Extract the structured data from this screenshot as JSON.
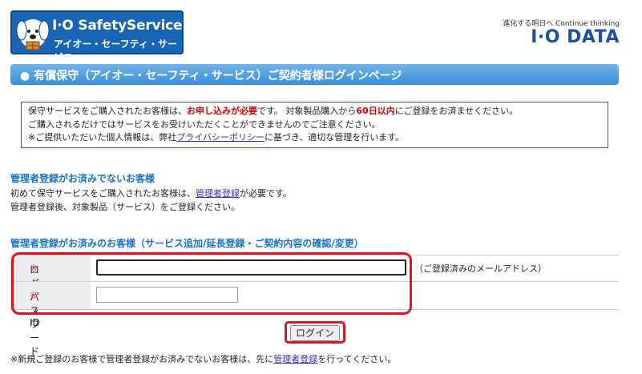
{
  "header": {
    "logo_title": "I·O SafetyService",
    "logo_subtitle": "アイオー・セーフティ・サービス",
    "tagline": "進化する明日へ Continue thinking",
    "brand": "I·O DATA"
  },
  "page_title": "● 有償保守（アイオー・セーフティ・サービス）ご契約者様ログインページ",
  "notice": {
    "line1_a": "保守サービスをご購入されたお客様は、",
    "line1_red": "お申し込みが必要",
    "line1_b": "です。 対象製品購入から",
    "line1_red2": "60日以内",
    "line1_c": "にご登録をお済ませください。",
    "line2": "ご購入されるだけではサービスをお受けいただくことができませんのでご注意ください。",
    "line3_a": "※ご提供いただいた個人情報は、弊社",
    "line3_link": "プライバシーポリシー",
    "line3_b": "に基づき、適切な管理を行います。"
  },
  "unregistered": {
    "heading": "管理者登録がお済みでないお客様",
    "line1_a": "初めて保守サービスをご購入されたお客様は、",
    "line1_link": "管理者登録",
    "line1_b": "が必要です。",
    "line2": "管理者登録後、対象製品（サービス）をご登録ください。"
  },
  "registered": {
    "heading": "管理者登録がお済みのお客様（サービス追加/延長登録・ご契約内容の確認/変更）"
  },
  "form": {
    "login_id_label": "ログインID",
    "password_label": "パスワード",
    "required_mark": "※",
    "login_id_value": "",
    "password_value": "",
    "login_id_hint": "（ご登録済みのメールアドレス）",
    "submit_label": "ログイン"
  },
  "footer": {
    "text_a": "※新規ご登録のお客様で管理者登録がお済みでないお客様は、先に",
    "link": "管理者登録",
    "text_b": "を行ってください。"
  },
  "colors": {
    "accent": "#1a73c4",
    "alert": "#d40000",
    "highlight": "#e0141a"
  }
}
